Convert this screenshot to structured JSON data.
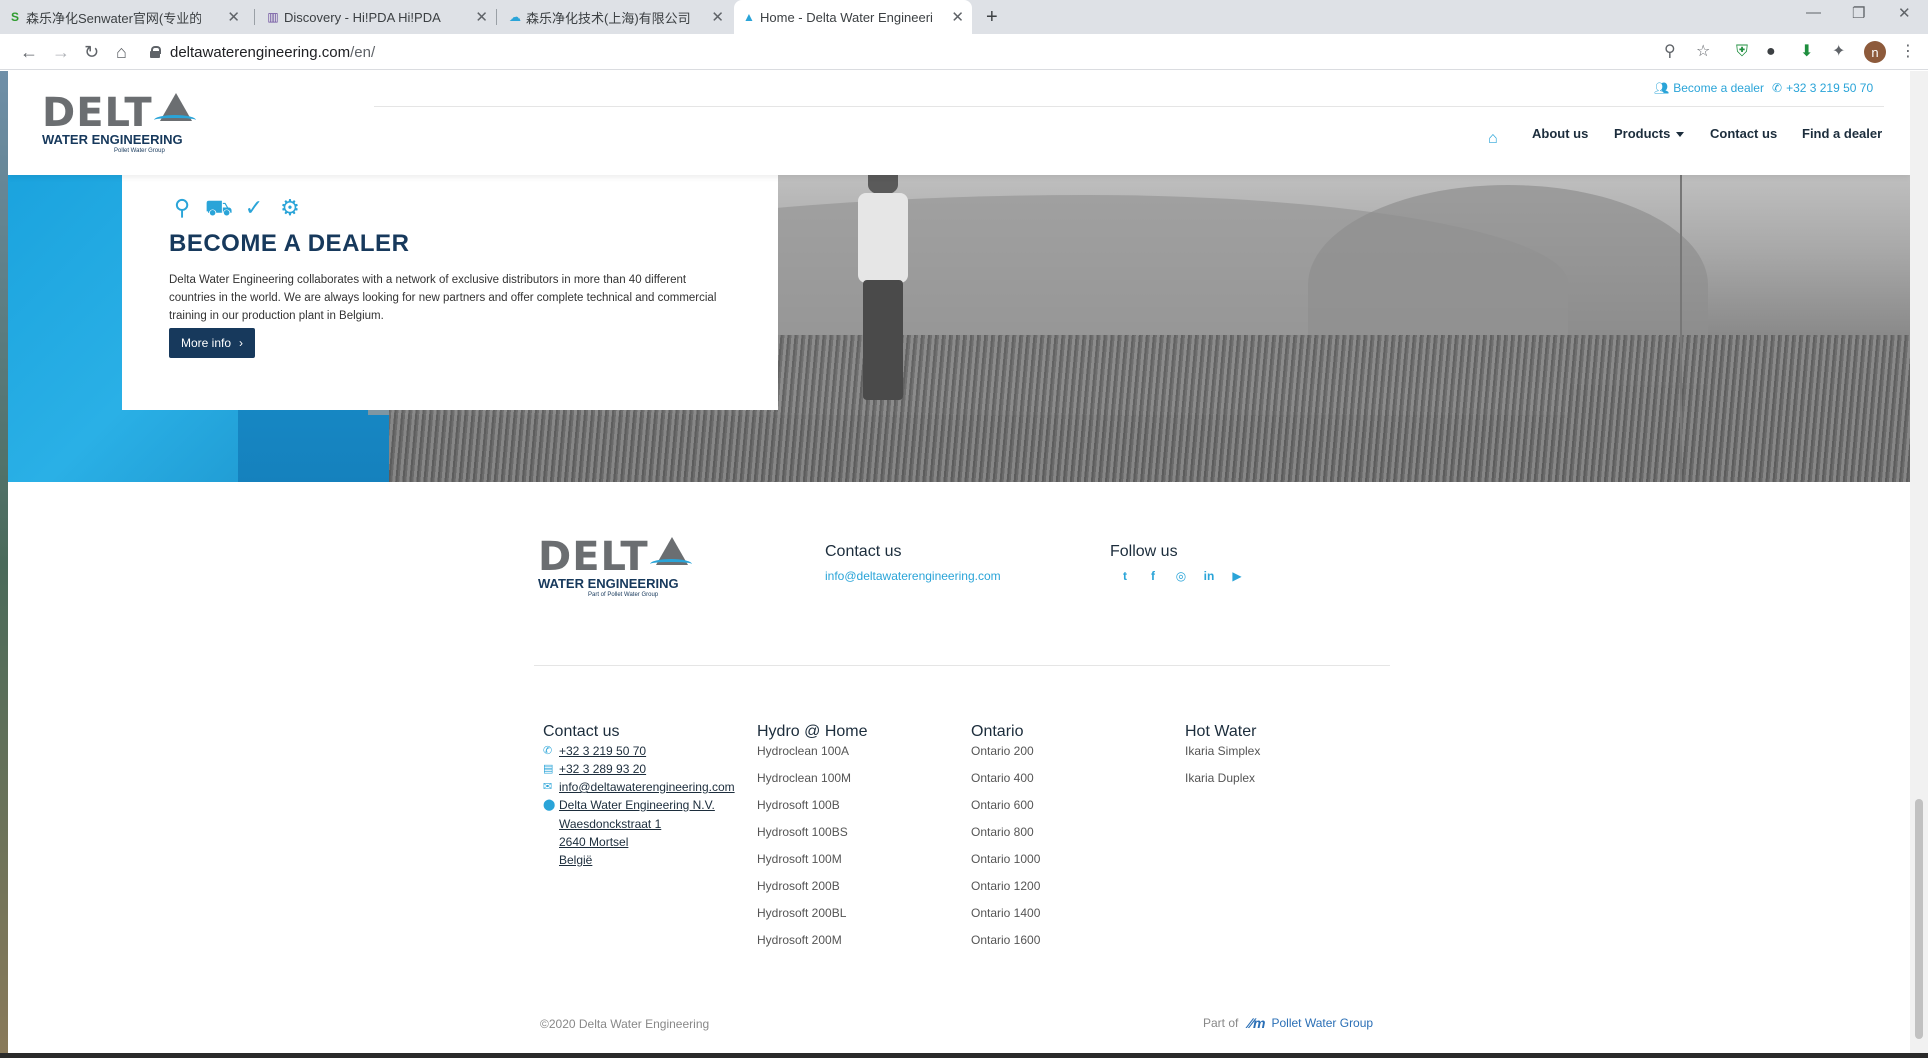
{
  "browser": {
    "tabs": [
      {
        "label": "森乐净化Senwater官网(专业的",
        "favicon": "S"
      },
      {
        "label": "Discovery - Hi!PDA Hi!PDA",
        "favicon": "▥"
      },
      {
        "label": "森乐净化技术(上海)有限公司",
        "favicon": "☁"
      },
      {
        "label": "Home - Delta Water Engineeri",
        "favicon": "▲"
      }
    ],
    "new_tab": "+",
    "close_glyph": "✕",
    "window_controls": {
      "minimize": "—",
      "restore": "❐",
      "close": "✕"
    },
    "address": {
      "domain": "deltawaterengineering.com",
      "path": "/en/"
    },
    "nav_glyphs": {
      "back": "←",
      "forward": "→",
      "reload": "↻",
      "home": "⌂"
    },
    "right_glyphs": {
      "zoom": "⚲",
      "star": "☆",
      "menu": "⋮"
    },
    "avatar_letter": "n"
  },
  "site": {
    "logo": {
      "big": "DELT",
      "sub": "WATER ENGINEERING",
      "pollet": "Pollet Water Group"
    },
    "toplinks": {
      "dealer": "Become a dealer",
      "phone": "+32 3 219 50 70"
    },
    "nav": {
      "home_icon": "⌂",
      "about": "About us",
      "products": "Products",
      "contact": "Contact us",
      "find_dealer": "Find a dealer"
    },
    "dealer": {
      "icons": [
        "⚲",
        "⛟",
        "✓",
        "⚙"
      ],
      "title": "BECOME A DEALER",
      "text": "Delta Water Engineering collaborates with a network of exclusive distributors in more than 40 different countries in the world. We are always looking for new partners and offer complete technical and commercial training in our production plant in Belgium.",
      "button": "More info",
      "button_chevron": "›"
    },
    "footer": {
      "logo": {
        "big": "DELT",
        "sub": "WATER ENGINEERING",
        "pollet": "Part of  Pollet Water Group"
      },
      "contact_head": "Contact us",
      "email": "info@deltawaterengineering.com",
      "follow_head": "Follow us",
      "social": [
        "t",
        "f",
        "◎",
        "in",
        "▶"
      ],
      "columns": {
        "contact": {
          "head": "Contact us",
          "phone": "+32 3 219 50 70",
          "fax": "+32 3 289 93 20",
          "email": "info@deltawaterengineering.com",
          "address": [
            "Delta Water Engineering N.V.",
            "Waesdonckstraat 1",
            "2640 Mortsel",
            "België"
          ]
        },
        "hydro": {
          "head": "Hydro @ Home",
          "items": [
            "Hydroclean 100A",
            "Hydroclean 100M",
            "Hydrosoft 100B",
            "Hydrosoft 100BS",
            "Hydrosoft 100M",
            "Hydrosoft 200B",
            "Hydrosoft 200BL",
            "Hydrosoft 200M"
          ]
        },
        "ontario": {
          "head": "Ontario",
          "items": [
            "Ontario 200",
            "Ontario 400",
            "Ontario 600",
            "Ontario 800",
            "Ontario 1000",
            "Ontario 1200",
            "Ontario 1400",
            "Ontario 1600"
          ]
        },
        "hotwater": {
          "head": "Hot Water",
          "items": [
            "Ikaria Simplex",
            "Ikaria Duplex"
          ]
        }
      },
      "copyright": "©2020  Delta Water Engineering",
      "part_of": "Part of",
      "pollet_mark": "∕∕m",
      "pollet_name": "Pollet Water Group"
    }
  },
  "colors": {
    "brand_navy": "#17395c",
    "brand_blue": "#2aa4d8",
    "logo_grey": "#6b6e71"
  }
}
